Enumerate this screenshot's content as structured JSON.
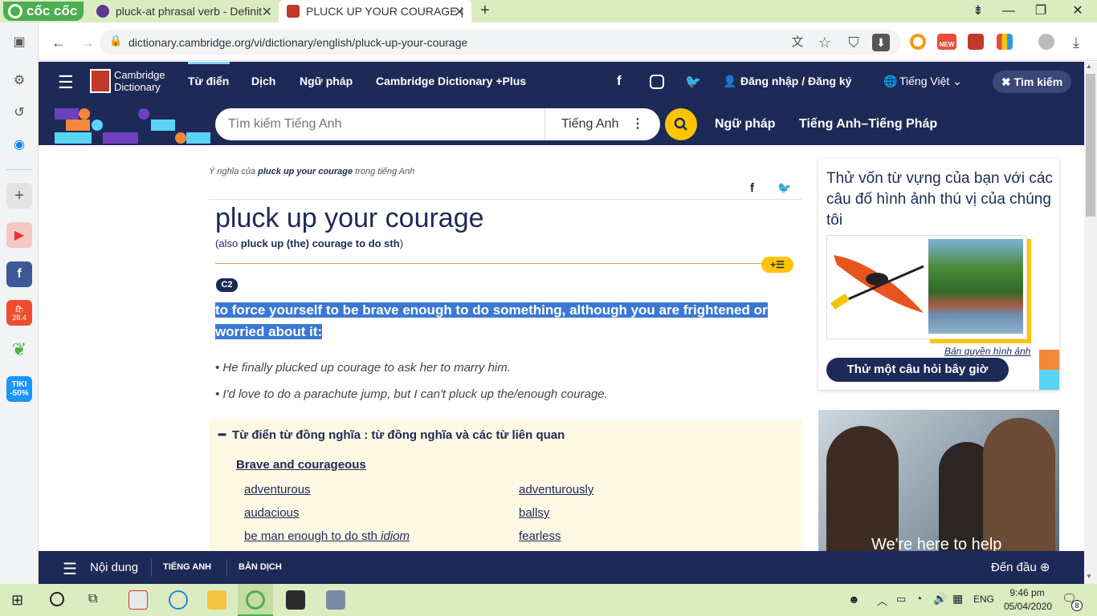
{
  "browser": {
    "brand": "cốc cốc",
    "tabs": [
      {
        "title": "pluck-at phrasal verb - Definit"
      },
      {
        "title": "PLUCK UP YOUR COURAGE | "
      }
    ],
    "new_tab": "+",
    "url": "dictionary.cambridge.org/vi/dictionary/english/pluck-up-your-courage",
    "ext_new_badge": "NEW"
  },
  "header": {
    "logo_line1": "Cambridge",
    "logo_line2": "Dictionary",
    "nav": [
      "Từ điển",
      "Dịch",
      "Ngữ pháp",
      "Cambridge Dictionary +Plus"
    ],
    "login": "Đăng nhập / Đăng ký",
    "language": "Tiếng Việt",
    "search_toggle": "Tìm kiếm",
    "search_placeholder": "Tìm kiếm Tiếng Anh",
    "search_lang": "Tiếng Anh",
    "sub_nav": [
      "Ngữ pháp",
      "Tiếng Anh–Tiếng Pháp"
    ]
  },
  "entry": {
    "crumb_pre": "Ý nghĩa của ",
    "crumb_word": "pluck up your courage",
    "crumb_post": " trong tiếng Anh",
    "headword": "pluck up your courage",
    "also_pre": "(also ",
    "also_word": "pluck up (the) courage to do sth",
    "also_post": ")",
    "level": "C2",
    "definition": "to force yourself to be brave enough to do something, although you are frightened or worried about it:",
    "examples": [
      "He finally plucked up courage to ask her to marry him.",
      "I'd love to do a parachute jump, but I can't pluck up the/enough courage."
    ]
  },
  "thesaurus": {
    "heading": "Từ điển từ đồng nghĩa : từ đồng nghĩa và các từ liên quan",
    "group": "Brave and courageous",
    "left": [
      "adventurous",
      "audacious",
      "be man enough to do sth"
    ],
    "left_note": "idiom",
    "right": [
      "adventurously",
      "ballsy",
      "fearless"
    ]
  },
  "quiz": {
    "title": "Thử vốn từ vựng của bạn với các câu đố hình ảnh thú vị của chúng tôi",
    "copyright": "Bản quyền hình ảnh",
    "button": "Thử một câu hỏi bây giờ"
  },
  "ad": {
    "text": "We're here to help"
  },
  "bottom": {
    "menu": "Nội dung",
    "tab1": "TIẾNG ANH",
    "tab2": "BẢN DỊCH",
    "top": "Đến đầu"
  },
  "taskbar": {
    "lang": "ENG",
    "time": "9:46 pm",
    "date": "05/04/2020",
    "notif": "8"
  },
  "sidebar": {
    "shopee_date": "28.4",
    "tiki_name": "TIKI",
    "tiki_discount": "-50%"
  },
  "colors": {
    "navy": "#1d2a57",
    "yellow": "#fec400",
    "highlight": "#3a78d4",
    "browser_green": "#dcecc1"
  }
}
